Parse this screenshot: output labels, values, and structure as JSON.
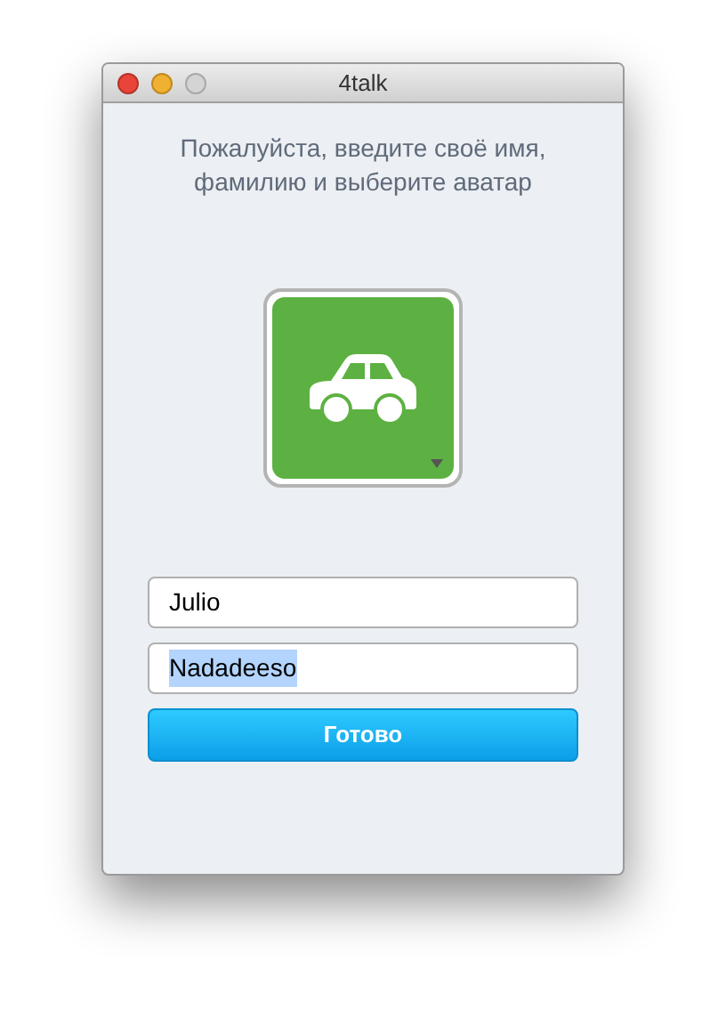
{
  "window": {
    "title": "4talk"
  },
  "prompt": "Пожалуйста, введите своё имя, фамилию и выберите аватар",
  "avatar": {
    "color": "#5db142"
  },
  "fields": [
    {
      "value": "Julio",
      "text_selected": false
    },
    {
      "value": "Nadadeeso",
      "text_selected": true
    }
  ],
  "button": "Готово"
}
